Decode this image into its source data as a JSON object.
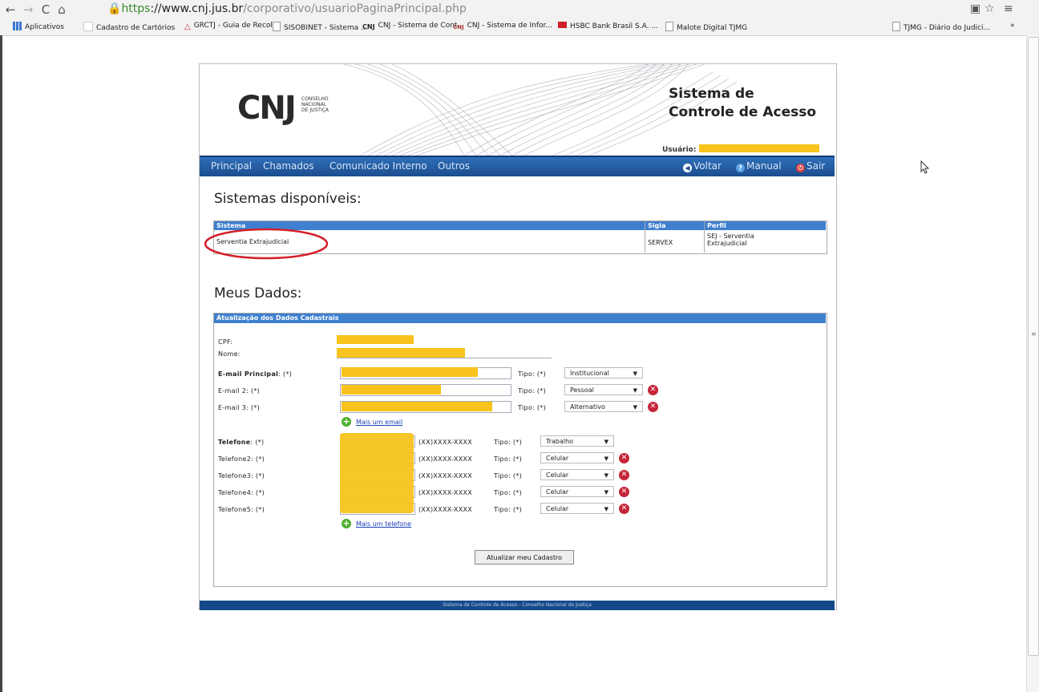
{
  "browser": {
    "url_https": "https",
    "url_host": "://www.cnj.jus.br",
    "url_path": "/corporativo/usuarioPaginaPrincipal.php",
    "bookmarks": [
      "Aplicativos",
      "Cadastro de Cartórios",
      "GRCTJ - Guia de Recol...",
      "SISOBINET - Sistema ...",
      "CNJ - Sistema de Cont...",
      "CNJ - Sistema de Infor...",
      "HSBC Bank Brasil S.A. ...",
      "Malote Digital TJMG",
      "TJMG - Diário do Judici...",
      "»"
    ]
  },
  "header": {
    "logo": "CNJ",
    "logo_sub": [
      "CONSELHO",
      "NACIONAL",
      "DE JUSTIÇA"
    ],
    "title_line1": "Sistema de",
    "title_line2": "Controle de Acesso",
    "user_label": "Usuário:"
  },
  "nav": {
    "items": [
      "Principal",
      "Chamados",
      "Comunicado Interno",
      "Outros"
    ],
    "voltar": "Voltar",
    "manual": "Manual",
    "sair": "Sair"
  },
  "sistemas": {
    "heading": "Sistemas disponíveis:",
    "columns": [
      "Sistema",
      "Sigla",
      "Perfil"
    ],
    "rows": [
      {
        "sistema": "Serventia Extrajudicial",
        "sigla": "SERVEX",
        "perfil_1": "SEJ - Serventia",
        "perfil_2": "Extrajudicial"
      }
    ]
  },
  "meus_dados": {
    "heading": "Meus Dados:",
    "panel_title": "Atualização dos Dados Cadastrais",
    "cpf_label": "CPF:",
    "nome_label": "Nome:",
    "tipo_label": "Tipo: (*)",
    "emails": [
      {
        "label_bold": "E-mail Principal",
        "label_rest": ": (*)",
        "tipo": "Institucional"
      },
      {
        "label_bold": "",
        "label_rest": "E-mail 2: (*)",
        "tipo": "Pessoal"
      },
      {
        "label_bold": "",
        "label_rest": "E-mail 3: (*)",
        "tipo": "Alternativo"
      }
    ],
    "add_email": "Mais um email",
    "phone_mask": "(XX)XXXX-XXXX",
    "phones": [
      {
        "label_bold": "Telefone",
        "label_rest": ": (*)",
        "tipo": "Trabalho"
      },
      {
        "label_bold": "",
        "label_rest": "Telefone2: (*)",
        "tipo": "Celular"
      },
      {
        "label_bold": "",
        "label_rest": "Telefone3: (*)",
        "tipo": "Celular"
      },
      {
        "label_bold": "",
        "label_rest": "Telefone4: (*)",
        "tipo": "Celular"
      },
      {
        "label_bold": "",
        "label_rest": "Telefone5: (*)",
        "tipo": "Celular"
      }
    ],
    "add_phone": "Mais um telefone",
    "submit": "Atualizar meu Cadastro"
  },
  "footer": "Sistema de Controle de Acesso - Conselho Nacional de Justiça",
  "colors": {
    "nav_blue": "#1b4d8f",
    "table_header_blue": "#3e7fcf",
    "redaction_yellow": "#f7c31c",
    "annotation_red": "#d4202a"
  }
}
